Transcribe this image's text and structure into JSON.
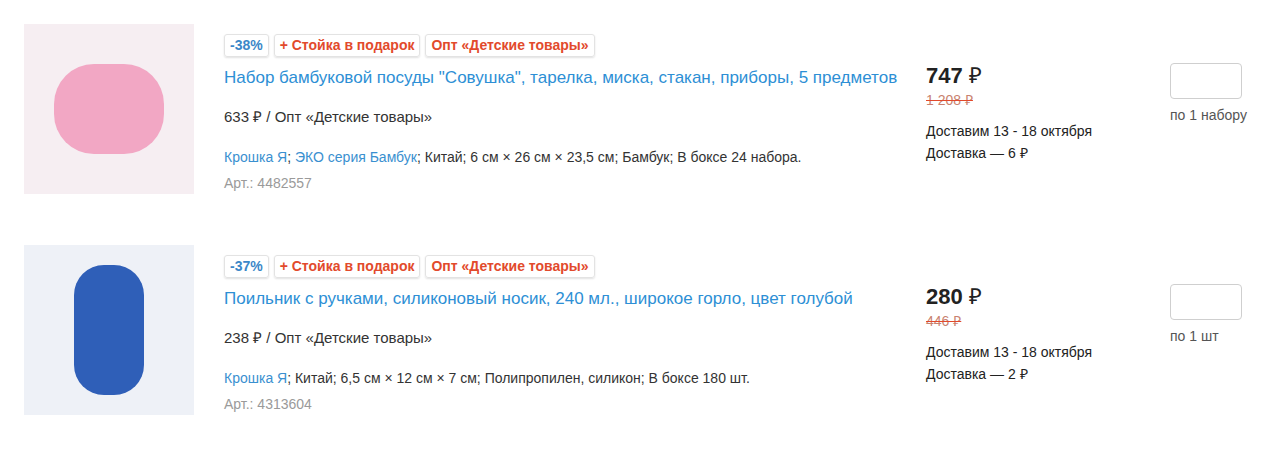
{
  "products": [
    {
      "discount": "-38%",
      "gift": "+ Стойка в подарок",
      "wholesale_badge": "Опт «Детские товары»",
      "title": "Набор бамбуковой посуды \"Совушка\", тарелка, миска, стакан, приборы, 5 предметов",
      "wholesale_price": "633 ₽",
      "wholesale_label": " / Опт «Детские товары»",
      "meta": [
        {
          "text": "Крошка Я",
          "link": true
        },
        {
          "text": "; ",
          "link": false
        },
        {
          "text": "ЭКО серия Бамбук",
          "link": true
        },
        {
          "text": "; Китай; 6 см × 26 см × 23,5 см; Бамбук; В боксе 24 набора.",
          "link": false
        }
      ],
      "article": "Арт.: 4482557",
      "price": "747",
      "currency": "₽",
      "old_price": "1 208 ₽",
      "delivery_dates": "Доставим 13 - 18 октября",
      "delivery_cost": "Доставка — 6 ₽",
      "quantity": "",
      "unit": "по 1 набору"
    },
    {
      "discount": "-37%",
      "gift": "+ Стойка в подарок",
      "wholesale_badge": "Опт «Детские товары»",
      "title": "Поильник с ручками, силиконовый носик, 240 мл., широкое горло, цвет голубой",
      "wholesale_price": "238 ₽",
      "wholesale_label": " / Опт «Детские товары»",
      "meta": [
        {
          "text": "Крошка Я",
          "link": true
        },
        {
          "text": "; Китай; 6,5 см × 12 см × 7 см; Полипропилен, силикон; В боксе 180 шт.",
          "link": false
        }
      ],
      "article": "Арт.: 4313604",
      "price": "280",
      "currency": "₽",
      "old_price": "446 ₽",
      "delivery_dates": "Доставим 13 - 18 октября",
      "delivery_cost": "Доставка — 2 ₽",
      "quantity": "",
      "unit": "по 1 шт"
    }
  ]
}
